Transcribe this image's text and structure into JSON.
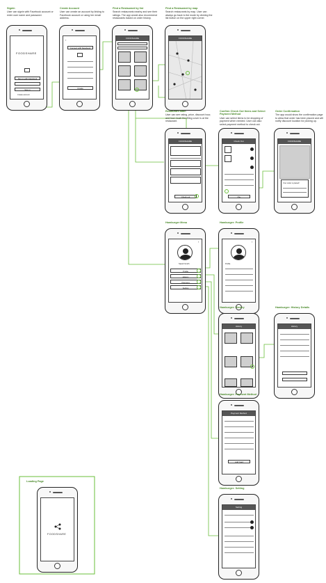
{
  "annotations": {
    "signin": {
      "title": "Signin",
      "body": "User can signin with Facebook account or enter user name and password."
    },
    "create_account": {
      "title": "Create Account",
      "body": "User can create an account by linking to Facebook account or using her email address."
    },
    "find_list": {
      "title": "Find a Restaurant by list",
      "body": "Search restaurants nearby and see their ratings. The app would also recommend restaurants based on order history."
    },
    "find_map": {
      "title": "Find a Restaurant by map",
      "body": "Search restaurants by map. User can always go back to list mode by clicking the list button on the upper right corner."
    },
    "restaurant_main": {
      "title": "Restaurant Main",
      "body": "User can see rating, price, discount hour, and how much the filling cover is at the restaurant."
    },
    "confirm_order": {
      "title": "Confirm Check Out Items and Select Payment Method",
      "body": "User can select items to be dropping of payment when needed. User can also select payment method to check out."
    },
    "order_confirmation": {
      "title": "Order Confirmation",
      "body": "The app would show the confirmation page to allow that order has been placed and will notify discount location for picking up."
    },
    "hamburger_menu": {
      "title": "Hamburger Menu"
    },
    "hamburger_profile": {
      "title": "Hamburger: Profile"
    },
    "hamburger_history": {
      "title": "Hamburger: History"
    },
    "hamburger_history_details": {
      "title": "Hamburger: History Details"
    },
    "hamburger_payment": {
      "title": "Hamburger: Payment Method"
    },
    "hamburger_setting": {
      "title": "Hamburger: Setting"
    },
    "loading_page": {
      "title": "Loading Page"
    }
  },
  "screens": {
    "signin": {
      "logo": "FOODSHARE",
      "btn_fb": "Sign in with Facebook",
      "btn_signin": "Sign in",
      "link": "Create account"
    },
    "create": {
      "btn_fb": "Connect with Facebook",
      "btn_create": "Create"
    },
    "list": {
      "header": "FOODSHARE"
    },
    "map": {
      "header": "FOODSHARE"
    },
    "restaurant": {
      "header": "FOODSHARE",
      "btn": "Check out"
    },
    "confirm": {
      "header": "Check Out",
      "btn": "Pay"
    },
    "confirmation": {
      "header": "FOODSHARE",
      "msg": "Your order is placed!"
    },
    "menu": {
      "user": "Sarah Smith",
      "items": [
        "Profile",
        "History",
        "Payment",
        "Setting"
      ]
    },
    "profile": {
      "header": "Profile"
    },
    "history": {
      "header": "History"
    },
    "history_details": {
      "header": "History"
    },
    "payment": {
      "header": "Payment Method",
      "btn": "Add Card"
    },
    "setting": {
      "header": "Setting"
    },
    "loading": {
      "logo": "FOODSHARE"
    }
  },
  "colors": {
    "accent": "#6abf3a",
    "wireframe": "#222222",
    "frame_bg": "#f7f7f7"
  }
}
